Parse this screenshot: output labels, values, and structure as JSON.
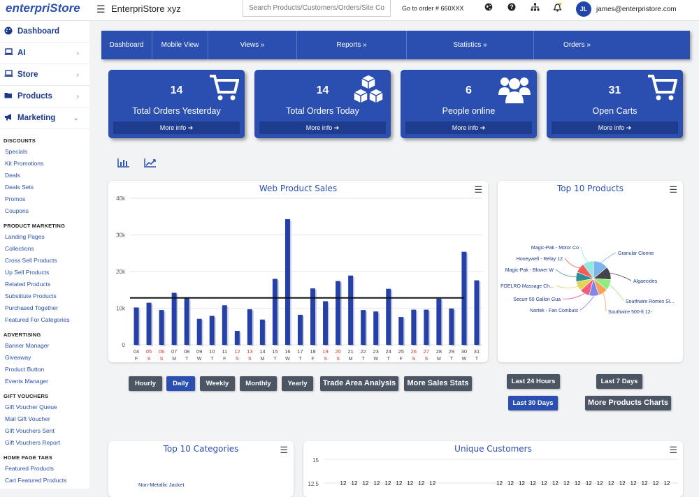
{
  "header": {
    "logo": "enterpriStore",
    "store_name": "EnterpriStore xyz",
    "search_placeholder": "Search Products/Customers/Orders/Site Config",
    "goto_order": "Go to order # 660XXX",
    "avatar_initials": "JL",
    "user_email": "james@enterpristore.com",
    "icons": [
      "globe-icon",
      "help-icon",
      "sitemap-icon",
      "bell-icon"
    ]
  },
  "sidebar": {
    "main": [
      {
        "label": "Dashboard",
        "icon": "palette-icon"
      },
      {
        "label": "AI",
        "icon": "laptop-icon"
      },
      {
        "label": "Store",
        "icon": "laptop-icon"
      },
      {
        "label": "Products",
        "icon": "folder-icon"
      },
      {
        "label": "Marketing",
        "icon": "bullhorn-icon"
      }
    ],
    "sections": [
      {
        "heading": "DISCOUNTS",
        "items": [
          "Specials",
          "Kit Promotions",
          "Deals",
          "Deals Sets",
          "Promos",
          "Coupons"
        ]
      },
      {
        "heading": "PRODUCT MARKETING",
        "items": [
          "Landing Pages",
          "Collections",
          "Cross Sell Products",
          "Up Sell Products",
          "Related Products",
          "Substitute Products",
          "Purchased Together",
          "Featured For Categories"
        ]
      },
      {
        "heading": "ADVERTISING",
        "items": [
          "Banner Manager",
          "Giveaway",
          "Product Button",
          "Events Manager"
        ]
      },
      {
        "heading": "GIFT VOUCHERS",
        "items": [
          "Gift Voucher Queue",
          "Mail Gift Voucher",
          "Gift Vouchers Sent",
          "Gift Vouchers Report"
        ]
      },
      {
        "heading": "HOME PAGE TABS",
        "items": [
          "Featured Products",
          "Cart Featured Products"
        ]
      }
    ]
  },
  "nav": [
    "Dashboard",
    "Mobile View",
    "Views »",
    "Reports »",
    "Statistics »",
    "Orders »"
  ],
  "cards": [
    {
      "value": "14",
      "label": "Total Orders Yesterday",
      "more": "More info ➔",
      "icon": "cart-icon"
    },
    {
      "value": "14",
      "label": "Total Orders Today",
      "more": "More info ➔",
      "icon": "cubes-icon"
    },
    {
      "value": "6",
      "label": "People online",
      "more": "More info ➔",
      "icon": "users-icon"
    },
    {
      "value": "31",
      "label": "Open Carts",
      "more": "More info ➔",
      "icon": "cart-icon"
    }
  ],
  "sales_buttons": [
    "Hourly",
    "Daily",
    "Weekly",
    "Monthly",
    "Yearly",
    "Trade Area Analysis",
    "More Sales Stats"
  ],
  "product_buttons": [
    "Last 24 Hours",
    "Last 7 Days",
    "Last 30 Days",
    "More Products Charts"
  ],
  "panels": {
    "sales_title": "Web Product Sales",
    "top_products_title": "Top 10 Products",
    "top_categories_title": "Top 10 Categories",
    "unique_customers_title": "Unique Customers"
  },
  "chart_data": [
    {
      "type": "bar",
      "title": "Web Product Sales",
      "ylim": [
        0,
        40000
      ],
      "yticks": [
        "0",
        "10k",
        "20k",
        "30k",
        "40k"
      ],
      "categories": [
        "04",
        "05",
        "06",
        "07",
        "08",
        "09",
        "10",
        "11",
        "12",
        "13",
        "14",
        "15",
        "16",
        "17",
        "18",
        "19",
        "20",
        "21",
        "22",
        "23",
        "24",
        "25",
        "26",
        "27",
        "28",
        "29",
        "30",
        "31"
      ],
      "weekdays": [
        "F",
        "S",
        "S",
        "M",
        "T",
        "W",
        "T",
        "F",
        "S",
        "S",
        "M",
        "T",
        "W",
        "T",
        "F",
        "S",
        "S",
        "M",
        "T",
        "W",
        "T",
        "F",
        "S",
        "S",
        "M",
        "T",
        "W",
        "T"
      ],
      "weekend_color": "#d9342b",
      "values": [
        10200,
        11500,
        9500,
        14200,
        12700,
        7100,
        7900,
        10800,
        3800,
        9700,
        6900,
        18000,
        34300,
        8200,
        15400,
        11900,
        17400,
        18900,
        9500,
        9100,
        15300,
        7600,
        9600,
        9600,
        12600,
        9900,
        25400,
        17600
      ],
      "reference_line": 12800,
      "grid": true
    },
    {
      "type": "pie",
      "title": "Top 10 Products",
      "labels": [
        "Granular Clorine",
        "Algaecides",
        "Southwire Romex SI...",
        "Southwire 500-ft 12-",
        "Nortek - Fan Combust",
        "Securr 55 Gallon Gua",
        "FOELRO Massage Ch...",
        "Magic-Pak - Blower W",
        "Honeywell - Relay 12",
        "Magic-Pak - Motor Co"
      ],
      "values": [
        14,
        12,
        10,
        9,
        9,
        9,
        9,
        9,
        9,
        10
      ],
      "colors": [
        "#7cb5ec",
        "#434348",
        "#90ed7d",
        "#f7a35c",
        "#8085e9",
        "#f15c80",
        "#e4d354",
        "#2b908f",
        "#f45b5b",
        "#91e8e1"
      ]
    },
    {
      "type": "line",
      "title": "Unique Customers",
      "yticks": [
        "12.5",
        "15"
      ],
      "data_labels": [
        "12",
        "12",
        "12",
        "12",
        "12",
        "12",
        "12",
        "12",
        "12",
        "12",
        "12",
        "12",
        "12",
        "12",
        "12",
        "12",
        "12",
        "12",
        "12",
        "12",
        "12",
        "12",
        "12",
        "12",
        "12"
      ]
    },
    {
      "type": "pie",
      "title": "Top 10 Categories",
      "labels": [
        "Non-Metallic Jacket"
      ]
    }
  ]
}
